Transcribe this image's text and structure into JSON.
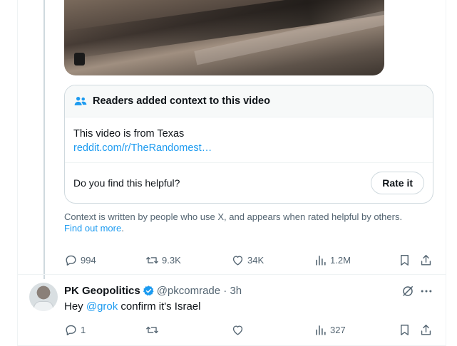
{
  "note": {
    "header_title": "Readers added context to this video",
    "body_text": "This video is from Texas",
    "body_link": "reddit.com/r/TheRandomest…",
    "helpful_question": "Do you find this helpful?",
    "rate_button": "Rate it"
  },
  "context_footer": {
    "text": "Context is written by people who use X, and appears when rated helpful by others.",
    "link": "Find out more",
    "period": "."
  },
  "main_actions": {
    "replies": "994",
    "reposts": "9.3K",
    "likes": "34K",
    "views": "1.2M"
  },
  "reply": {
    "name": "PK Geopolitics",
    "handle_time": "@pkcomrade · 3h",
    "text_before": "Hey ",
    "mention": "@grok",
    "text_after": " confirm it's Israel",
    "actions": {
      "replies": "1",
      "reposts": "",
      "likes": "",
      "views": "327"
    }
  },
  "colors": {
    "accent": "#1d9bf0",
    "secondary_text": "#536471",
    "border": "#cfd9de"
  },
  "icons": [
    "people-icon",
    "reply-icon",
    "repost-icon",
    "like-icon",
    "views-icon",
    "bookmark-icon",
    "share-icon",
    "verified-icon",
    "grok-icon",
    "more-icon"
  ]
}
